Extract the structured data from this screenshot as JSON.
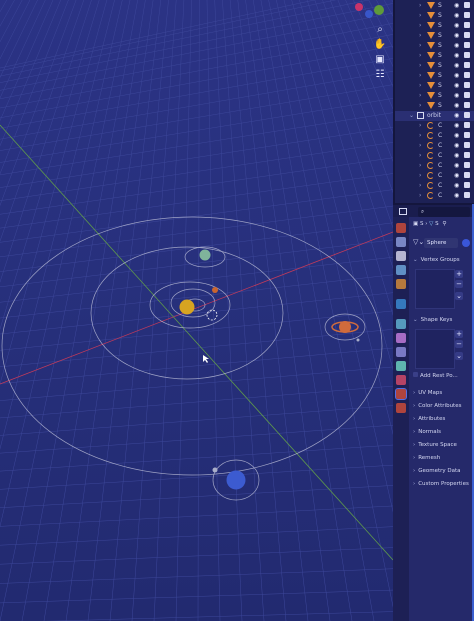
{
  "viewport": {
    "title": "",
    "nav_buttons": [
      {
        "name": "zoom-icon",
        "glyph": "⌕"
      },
      {
        "name": "hand-pan-icon",
        "glyph": "✋"
      },
      {
        "name": "camera-view-icon",
        "glyph": "▣"
      },
      {
        "name": "grid-toggle-icon",
        "glyph": "☷"
      }
    ],
    "colors": {
      "grid": "#3d479a",
      "x_axis": "#c33a5a",
      "y_axis": "#5f9a4a",
      "orbit": "#c9cbe0",
      "sun": "#d7a421",
      "mercury": "#c9652f",
      "venus": "#7fb39b",
      "saturn": "#d06b3c",
      "neptune": "#3c5bd0"
    }
  },
  "outliner": {
    "rows": [
      {
        "icon": "cone-icon",
        "name": "S"
      },
      {
        "icon": "cone-icon",
        "name": "S"
      },
      {
        "icon": "cone-icon",
        "name": "S"
      },
      {
        "icon": "cone-icon",
        "name": "S"
      },
      {
        "icon": "cone-icon",
        "name": "S"
      },
      {
        "icon": "cone-icon",
        "name": "S"
      },
      {
        "icon": "cone-icon",
        "name": "S"
      },
      {
        "icon": "cone-icon",
        "name": "S"
      },
      {
        "icon": "cone-icon",
        "name": "S"
      },
      {
        "icon": "cone-icon",
        "name": "S"
      },
      {
        "icon": "cone-icon",
        "name": "S"
      },
      {
        "icon": "collection-icon",
        "name": "orbit"
      },
      {
        "icon": "curve-icon",
        "name": "C"
      },
      {
        "icon": "curve-icon",
        "name": "C"
      },
      {
        "icon": "curve-icon",
        "name": "C"
      },
      {
        "icon": "curve-icon",
        "name": "C"
      },
      {
        "icon": "curve-icon",
        "name": "C"
      },
      {
        "icon": "curve-icon",
        "name": "C"
      },
      {
        "icon": "curve-icon",
        "name": "C"
      },
      {
        "icon": "curve-icon",
        "name": "C"
      }
    ]
  },
  "properties": {
    "breadcrumb": [
      "S",
      "S"
    ],
    "mesh_name": "Sphere",
    "panels": {
      "vertex_groups": "Vertex Groups",
      "shape_keys": "Shape Keys",
      "add_rest_position": "Add Rest Po...",
      "uv_maps": "UV Maps",
      "color_attributes": "Color Attributes",
      "attributes": "Attributes",
      "normals": "Normals",
      "texture_space": "Texture Space",
      "remesh": "Remesh",
      "geometry_data": "Geometry Data",
      "custom_properties": "Custom Properties"
    },
    "tab_colors": [
      "#c94b3a",
      "#8a9ad8",
      "#d0d0e8",
      "#6ba3d8",
      "#d08a3a",
      "#3a8ad0",
      "#5fb0d0",
      "#c07ad8",
      "#8a8ad8",
      "#6ad0c0",
      "#d04a6a",
      "#c94b3a"
    ]
  }
}
